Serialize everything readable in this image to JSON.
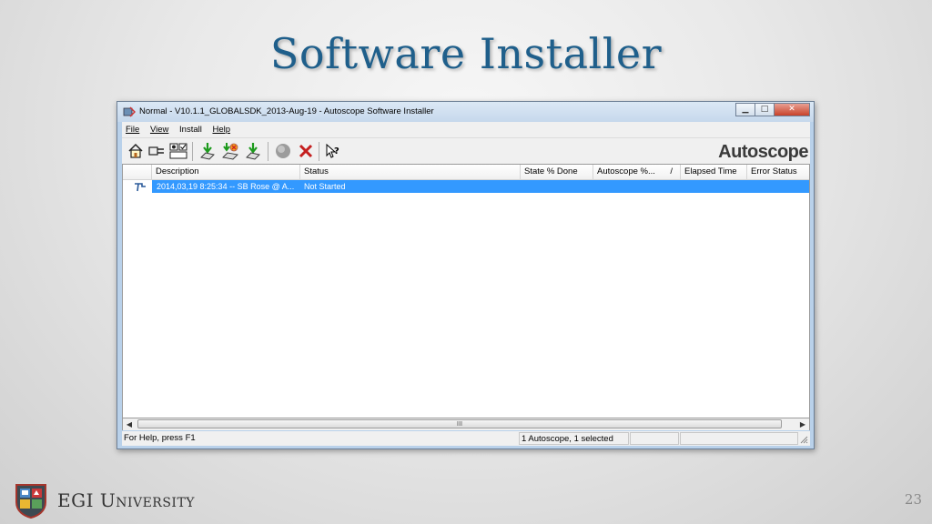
{
  "slide": {
    "title": "Software Installer",
    "footer_name": "EGI University",
    "page_number": "23"
  },
  "window": {
    "title": "Normal - V10.1.1_GLOBALSDK_2013-Aug-19 - Autoscope Software Installer",
    "menu": [
      "File",
      "View",
      "Install",
      "Help"
    ],
    "toolbar_icons": [
      "home-icon",
      "connect-plug-icon",
      "checkbox-settings-icon",
      "install-arrow-icon",
      "install-multi-icon",
      "download-arrow-icon",
      "stop-icon",
      "cancel-x-icon",
      "context-help-icon"
    ],
    "brand": "Autoscope",
    "columns": [
      "Description",
      "Status",
      "State % Done",
      "Autoscope %...",
      "Elapsed Time",
      "Error Status"
    ],
    "sort_indicator": "/",
    "rows": [
      {
        "description": "2014,03,19  8:25:34 -- SB Rose @ A...",
        "status": "Not Started",
        "selected": true
      }
    ],
    "scroll_thumb_glyph": "III",
    "status_help": "For Help, press F1",
    "status_selection": "1 Autoscope, 1 selected",
    "colors": {
      "selection": "#3399ff",
      "title_text": "#1f5f8b"
    }
  }
}
